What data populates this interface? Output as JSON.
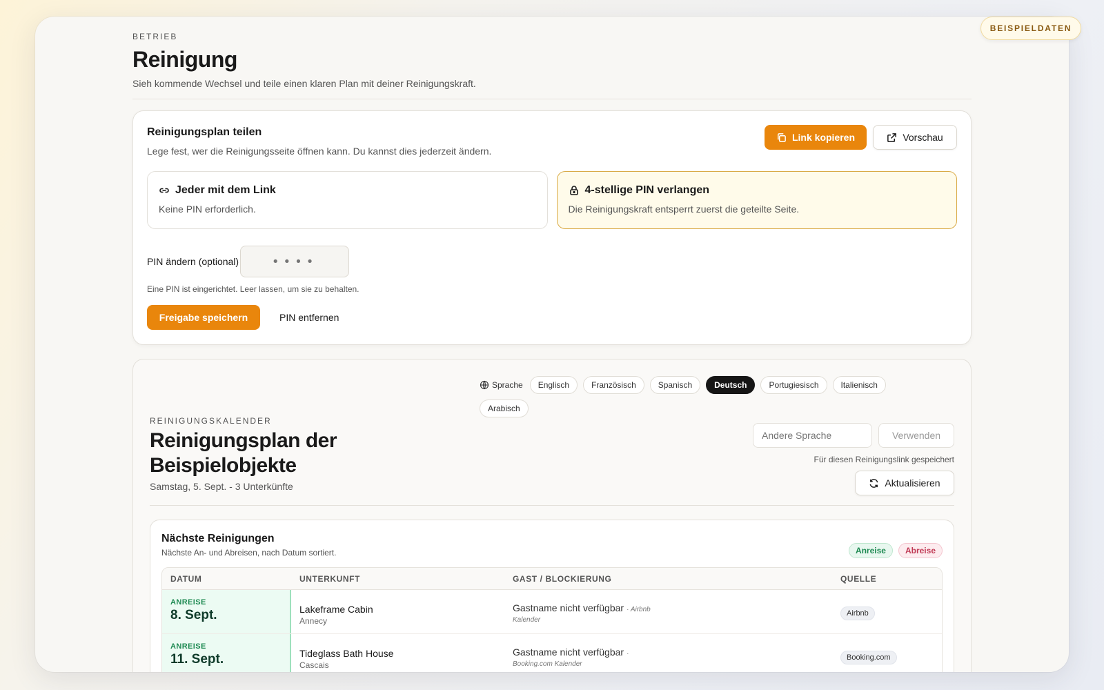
{
  "demo_badge": "BEISPIELDATEN",
  "header": {
    "eyebrow": "BETRIEB",
    "title": "Reinigung",
    "subtitle": "Sieh kommende Wechsel und teile einen klaren Plan mit deiner Reinigungskraft."
  },
  "share": {
    "title": "Reinigungsplan teilen",
    "description": "Lege fest, wer die Reinigungsseite öffnen kann. Du kannst dies jederzeit ändern.",
    "copy_link": "Link kopieren",
    "preview": "Vorschau",
    "options": [
      {
        "title": "Jeder mit dem Link",
        "description": "Keine PIN erforderlich.",
        "icon": "link-icon",
        "selected": false
      },
      {
        "title": "4-stellige PIN verlangen",
        "description": "Die Reinigungskraft entsperrt zuerst die geteilte Seite.",
        "icon": "lock-icon",
        "selected": true
      }
    ],
    "pin_label": "PIN ändern (optional)",
    "pin_placeholder": "••••",
    "pin_hint": "Eine PIN ist eingerichtet. Leer lassen, um sie zu behalten.",
    "save": "Freigabe speichern",
    "remove_pin": "PIN entfernen"
  },
  "calendar": {
    "language_label": "Sprache",
    "languages": [
      "Englisch",
      "Französisch",
      "Spanisch",
      "Deutsch",
      "Portugiesisch",
      "Italienisch",
      "Arabisch"
    ],
    "active_language": "Deutsch",
    "eyebrow": "REINIGUNGSKALENDER",
    "title": "Reinigungsplan der Beispielobjekte",
    "meta": "Samstag, 5. Sept. - 3 Unterkünfte",
    "other_language_placeholder": "Andere Sprache",
    "apply": "Verwenden",
    "saved_note": "Für diesen Reinigungslink gespeichert",
    "refresh": "Aktualisieren"
  },
  "next": {
    "title": "Nächste Reinigungen",
    "description": "Nächste An- und Abreisen, nach Datum sortiert.",
    "legend_arrival": "Anreise",
    "legend_departure": "Abreise",
    "columns": [
      "DATUM",
      "UNTERKUNFT",
      "GAST / BLOCKIERUNG",
      "QUELLE"
    ],
    "rows": [
      {
        "kind": "ANREISE",
        "date": "8. Sept.",
        "unit": "Lakeframe Cabin",
        "location": "Annecy",
        "guest": "Gastname nicht verfügbar",
        "guest_source": "· Airbnb",
        "guest_sub": "Kalender",
        "source": "Airbnb"
      },
      {
        "kind": "ANREISE",
        "date": "11. Sept.",
        "unit": "Tideglass Bath House",
        "location": "Cascais",
        "guest": "Gastname nicht verfügbar",
        "guest_source": "·",
        "guest_sub": "Booking.com Kalender",
        "source": "Booking.com"
      }
    ]
  },
  "colors": {
    "accent": "#e9860c",
    "arrival": "#1e8a52",
    "departure": "#c03a55"
  }
}
